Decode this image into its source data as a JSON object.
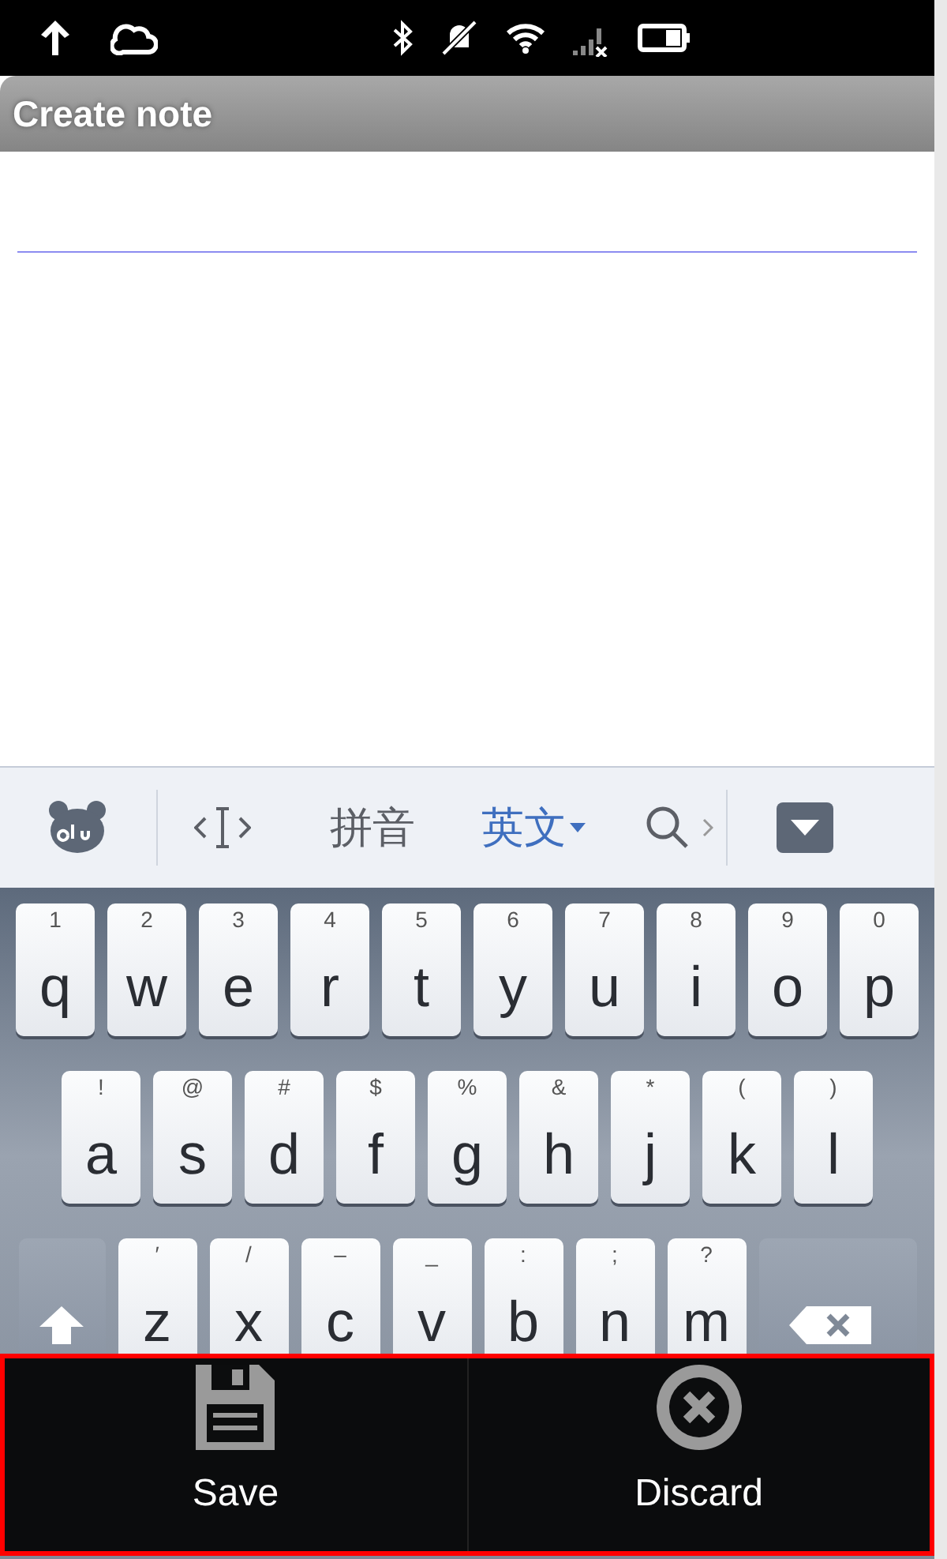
{
  "title_bar": {
    "title": "Create note"
  },
  "ime_toolbar": {
    "modes": [
      {
        "label": "拼音",
        "selected": false
      },
      {
        "label": "英文",
        "selected": true
      }
    ]
  },
  "keyboard": {
    "rows": [
      {
        "keys": [
          {
            "kind": "char",
            "hint": "1",
            "label": "q"
          },
          {
            "kind": "char",
            "hint": "2",
            "label": "w"
          },
          {
            "kind": "char",
            "hint": "3",
            "label": "e"
          },
          {
            "kind": "char",
            "hint": "4",
            "label": "r"
          },
          {
            "kind": "char",
            "hint": "5",
            "label": "t"
          },
          {
            "kind": "char",
            "hint": "6",
            "label": "y"
          },
          {
            "kind": "char",
            "hint": "7",
            "label": "u"
          },
          {
            "kind": "char",
            "hint": "8",
            "label": "i"
          },
          {
            "kind": "char",
            "hint": "9",
            "label": "o"
          },
          {
            "kind": "char",
            "hint": "0",
            "label": "p"
          }
        ]
      },
      {
        "keys": [
          {
            "kind": "char",
            "hint": "!",
            "label": "a"
          },
          {
            "kind": "char",
            "hint": "@",
            "label": "s"
          },
          {
            "kind": "char",
            "hint": "#",
            "label": "d"
          },
          {
            "kind": "char",
            "hint": "$",
            "label": "f"
          },
          {
            "kind": "char",
            "hint": "%",
            "label": "g"
          },
          {
            "kind": "char",
            "hint": "&",
            "label": "h"
          },
          {
            "kind": "char",
            "hint": "*",
            "label": "j"
          },
          {
            "kind": "char",
            "hint": "(",
            "label": "k"
          },
          {
            "kind": "char",
            "hint": ")",
            "label": "l"
          }
        ]
      },
      {
        "keys": [
          {
            "kind": "shift"
          },
          {
            "kind": "char",
            "hint": "′",
            "label": "z"
          },
          {
            "kind": "char",
            "hint": "/",
            "label": "x"
          },
          {
            "kind": "char",
            "hint": "–",
            "label": "c"
          },
          {
            "kind": "char",
            "hint": "_",
            "label": "v"
          },
          {
            "kind": "char",
            "hint": ":",
            "label": "b"
          },
          {
            "kind": "char",
            "hint": ";",
            "label": "n"
          },
          {
            "kind": "char",
            "hint": "?",
            "label": "m"
          },
          {
            "kind": "backspace"
          }
        ]
      }
    ]
  },
  "action_bar": {
    "buttons": [
      {
        "kind": "save",
        "label": "Save"
      },
      {
        "kind": "discard",
        "label": "Discard"
      }
    ]
  }
}
